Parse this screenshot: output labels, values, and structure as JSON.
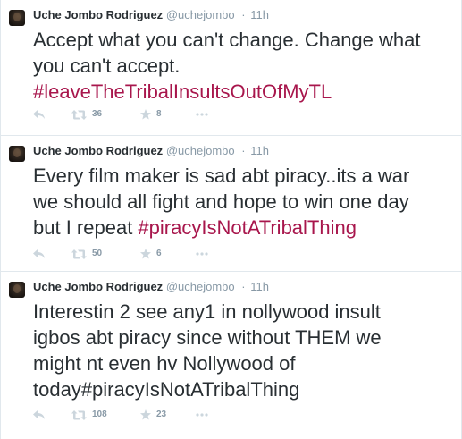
{
  "tweets": [
    {
      "author_name": "Uche Jombo Rodriguez",
      "handle": "@uchejombo",
      "separator": "·",
      "time": "11h",
      "text_lines": [
        {
          "plain": "Accept what you can't change. Change what",
          "hashtag": ""
        },
        {
          "plain": "you can't accept.",
          "hashtag": ""
        },
        {
          "plain": "",
          "hashtag": "#leaveTheTribalInsultsOutOfMyTL"
        }
      ],
      "retweets": "36",
      "favorites": "8"
    },
    {
      "author_name": "Uche Jombo Rodriguez",
      "handle": "@uchejombo",
      "separator": "·",
      "time": "11h",
      "text_lines": [
        {
          "plain": "Every film maker is sad abt piracy..its a war",
          "hashtag": ""
        },
        {
          "plain": "we should all fight and hope to win one day",
          "hashtag": ""
        },
        {
          "plain": "but I repeat ",
          "hashtag": "#piracyIsNotATribalThing"
        }
      ],
      "retweets": "50",
      "favorites": "6"
    },
    {
      "author_name": "Uche Jombo Rodriguez",
      "handle": "@uchejombo",
      "separator": "·",
      "time": "11h",
      "text_lines": [
        {
          "plain": "Interestin 2 see any1 in nollywood insult",
          "hashtag": ""
        },
        {
          "plain": "igbos abt piracy since without THEM we",
          "hashtag": ""
        },
        {
          "plain": "might nt even hv Nollywood of",
          "hashtag": ""
        },
        {
          "plain": "today#piracyIsNotATribalThing",
          "hashtag": ""
        }
      ],
      "retweets": "108",
      "favorites": "23"
    }
  ],
  "icons": {
    "reply": "reply-icon",
    "retweet": "retweet-icon",
    "favorite": "star-icon",
    "more": "more-icon"
  },
  "colors": {
    "hashtag": "#a8164c",
    "muted": "#8899a6",
    "text": "#292f33",
    "icon": "#ccd6dd",
    "divider": "#e1e8ed"
  }
}
